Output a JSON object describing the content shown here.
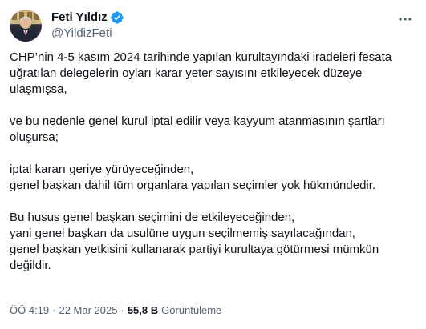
{
  "author": {
    "display_name": "Feti Yıldız",
    "handle": "@YildizFeti",
    "verified": true,
    "verified_color": "#1d9bf0"
  },
  "tweet": {
    "paragraphs": [
      {
        "lines": [
          "CHP’nin 4-5 kasım 2024 tarihinde yapılan kurultayındaki iradeleri fesata",
          "uğratılan delegelerin oyları  karar yeter sayısını etkileyecek düzeye",
          "ulaşmışsa,"
        ]
      },
      {
        "lines": [
          "ve bu nedenle genel kurul iptal edilir veya kayyum atanmasının şartları",
          "oluşursa;"
        ]
      },
      {
        "lines": [
          "iptal kararı geriye yürüyeceğinden,",
          "genel başkan dahil tüm organlara yapılan seçimler yok hükmündedir."
        ]
      },
      {
        "lines": [
          "Bu husus genel başkan seçimini de etkileyeceğinden,",
          "yani genel başkan da usulüne uygun seçilmemiş sayılacağından,",
          "genel başkan yetkisini kullanarak partiyi kurultaya götürmesi mümkün",
          "değildir."
        ]
      }
    ]
  },
  "meta": {
    "time": "ÖÖ 4:19",
    "separator": "·",
    "date": "22 Mar 2025",
    "separator2": "·",
    "views_count": "55,8 B",
    "views_label": "Görüntüleme"
  },
  "icons": {
    "verified": "verified-badge-icon",
    "more": "more-options-icon"
  },
  "colors": {
    "text_primary": "#0f1419",
    "text_secondary": "#536471",
    "accent": "#1d9bf0"
  }
}
